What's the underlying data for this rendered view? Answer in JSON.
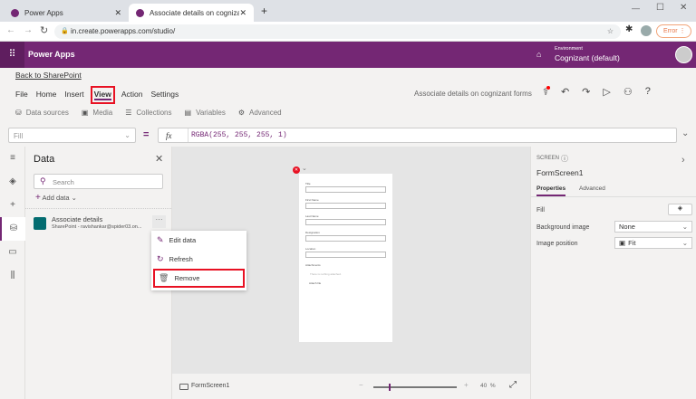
{
  "browser": {
    "tabs": [
      {
        "title": "Power Apps"
      },
      {
        "title": "Associate details on cognizant fo"
      }
    ],
    "url": "in.create.powerapps.com/studio/",
    "error_label": "Error"
  },
  "header": {
    "app_name": "Power Apps",
    "env_label": "Environment",
    "env_name": "Cognizant (default)"
  },
  "back_link": "Back to SharePoint",
  "menu": {
    "items": [
      "File",
      "Home",
      "Insert",
      "View",
      "Action",
      "Settings"
    ],
    "active": "View",
    "app_title": "Associate details on cognizant forms"
  },
  "toolbar": {
    "items": [
      "Data sources",
      "Media",
      "Collections",
      "Variables",
      "Advanced"
    ]
  },
  "formula": {
    "property": "Fill",
    "fx": "fx",
    "equals": "=",
    "value": "RGBA(255, 255, 255, 1)"
  },
  "data_panel": {
    "title": "Data",
    "search_placeholder": "Search",
    "add_data": "Add data",
    "source": {
      "name": "Associate details",
      "subtitle": "SharePoint - ravishankar@spider03.on...",
      "more": "···"
    }
  },
  "context_menu": {
    "items": [
      "Edit data",
      "Refresh",
      "Remove"
    ],
    "highlighted": "Remove"
  },
  "form": {
    "fields": [
      "Title",
      "First Name",
      "Last Name",
      "Designation",
      "Location"
    ],
    "attachments_label": "Attachments",
    "attachments_empty": "There is nothing attached.",
    "attach_file": "Attach file"
  },
  "bottom_bar": {
    "screen": "FormScreen1",
    "zoom": "40",
    "zoom_unit": "%",
    "zoom_minus": "−",
    "zoom_plus": "+"
  },
  "right_panel": {
    "type_label": "SCREEN",
    "screen_name": "FormScreen1",
    "tabs": [
      "Properties",
      "Advanced"
    ],
    "active_tab": "Properties",
    "props": [
      {
        "label": "Fill"
      },
      {
        "label": "Background image",
        "value": "None"
      },
      {
        "label": "Image position",
        "value": "Fit"
      }
    ]
  },
  "colors": {
    "brand": "#742774",
    "highlight": "#e81123"
  }
}
